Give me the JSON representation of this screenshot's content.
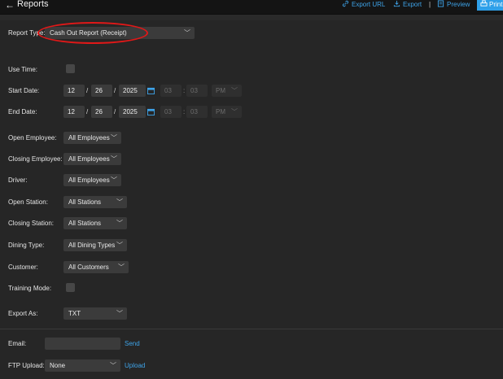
{
  "header": {
    "back_glyph": "←",
    "title": "Reports",
    "export_url": "Export URL",
    "export": "Export",
    "separator": "|",
    "preview": "Preview",
    "print": "Print"
  },
  "form": {
    "report_type": {
      "label": "Report Type:",
      "value": "Cash Out Report (Receipt)"
    },
    "use_time": {
      "label": "Use Time:",
      "checked": false
    },
    "start_date": {
      "label": "Start Date:",
      "month": "12",
      "day": "26",
      "year": "2025",
      "hour": "03",
      "minute": "03",
      "ampm": "PM"
    },
    "end_date": {
      "label": "End Date:",
      "month": "12",
      "day": "26",
      "year": "2025",
      "hour": "03",
      "minute": "03",
      "ampm": "PM"
    },
    "open_employee": {
      "label": "Open Employee:",
      "value": "All Employees"
    },
    "closing_employee": {
      "label": "Closing Employee:",
      "value": "All Employees"
    },
    "driver": {
      "label": "Driver:",
      "value": "All Employees"
    },
    "open_station": {
      "label": "Open Station:",
      "value": "All Stations"
    },
    "closing_station": {
      "label": "Closing Station:",
      "value": "All Stations"
    },
    "dining_type": {
      "label": "Dining Type:",
      "value": "All Dining Types"
    },
    "customer": {
      "label": "Customer:",
      "value": "All Customers"
    },
    "training_mode": {
      "label": "Training Mode:",
      "checked": false
    },
    "export_as": {
      "label": "Export As:",
      "value": "TXT"
    }
  },
  "footer": {
    "email": {
      "label": "Email:",
      "value": "",
      "action": "Send"
    },
    "ftp": {
      "label": "FTP Upload:",
      "value": "None",
      "action": "Upload"
    }
  },
  "colors": {
    "accent": "#2fa0e9",
    "link": "#3ea3e8",
    "annotation": "#e01818",
    "background": "#262626"
  },
  "icons": [
    "back-arrow-icon",
    "link-icon",
    "download-icon",
    "preview-icon",
    "print-icon",
    "calendar-icon",
    "chevron-down-icon"
  ]
}
